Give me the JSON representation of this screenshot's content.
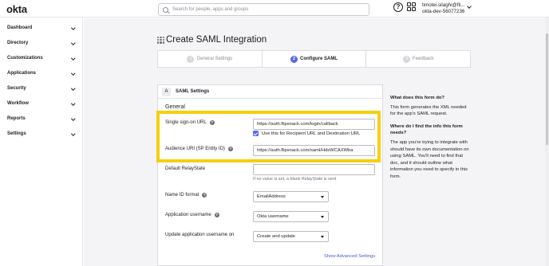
{
  "topbar": {
    "logo": "okta",
    "search_placeholder": "Search for people, apps and groups",
    "user_email": "timotei.silaghi@fli...",
    "user_org": "okta-dev-56077236"
  },
  "sidebar": {
    "items": [
      {
        "label": "Dashboard"
      },
      {
        "label": "Directory"
      },
      {
        "label": "Customizations"
      },
      {
        "label": "Applications"
      },
      {
        "label": "Security"
      },
      {
        "label": "Workflow"
      },
      {
        "label": "Reports"
      },
      {
        "label": "Settings"
      }
    ]
  },
  "page": {
    "title": "Create SAML Integration"
  },
  "wizard": {
    "steps": [
      {
        "num": "1",
        "label": "General Settings"
      },
      {
        "num": "2",
        "label": "Configure SAML"
      },
      {
        "num": "3",
        "label": "Feedback"
      }
    ]
  },
  "form": {
    "section_badge": "A",
    "section_title": "SAML Settings",
    "subsection": "General",
    "sso_url_label": "Single sign-on URL",
    "sso_url_value": "https://auth.flipsnack.com/login/callback",
    "recipient_checkbox_label": "Use this for Recipient URL and Destination URL",
    "audience_label": "Audience URI (SP Entity ID)",
    "audience_value": "https://auth.flipsnack.com/saml/HdsWCAXWba",
    "relay_label": "Default RelayState",
    "relay_value": "",
    "relay_hint": "If no value is set, a blank RelayState is sent",
    "nameid_label": "Name ID format",
    "nameid_value": "EmailAddress",
    "app_username_label": "Application username",
    "app_username_value": "Okta username",
    "update_label": "Update application username on",
    "update_value": "Create and update",
    "advanced_link": "Show Advanced Settings"
  },
  "help": {
    "q1": "What does this form do?",
    "a1": "This form generates the XML needed for the app's SAML request.",
    "q2": "Where do I find the info this form needs?",
    "a2": "The app you're trying to integrate with should have its own documentation on using SAML. You'll need to find that doc, and it should outline what information you need to specify in this form."
  },
  "colors": {
    "accent": "#546be7",
    "highlight": "#f5cf0e",
    "link": "#3f59e4"
  }
}
